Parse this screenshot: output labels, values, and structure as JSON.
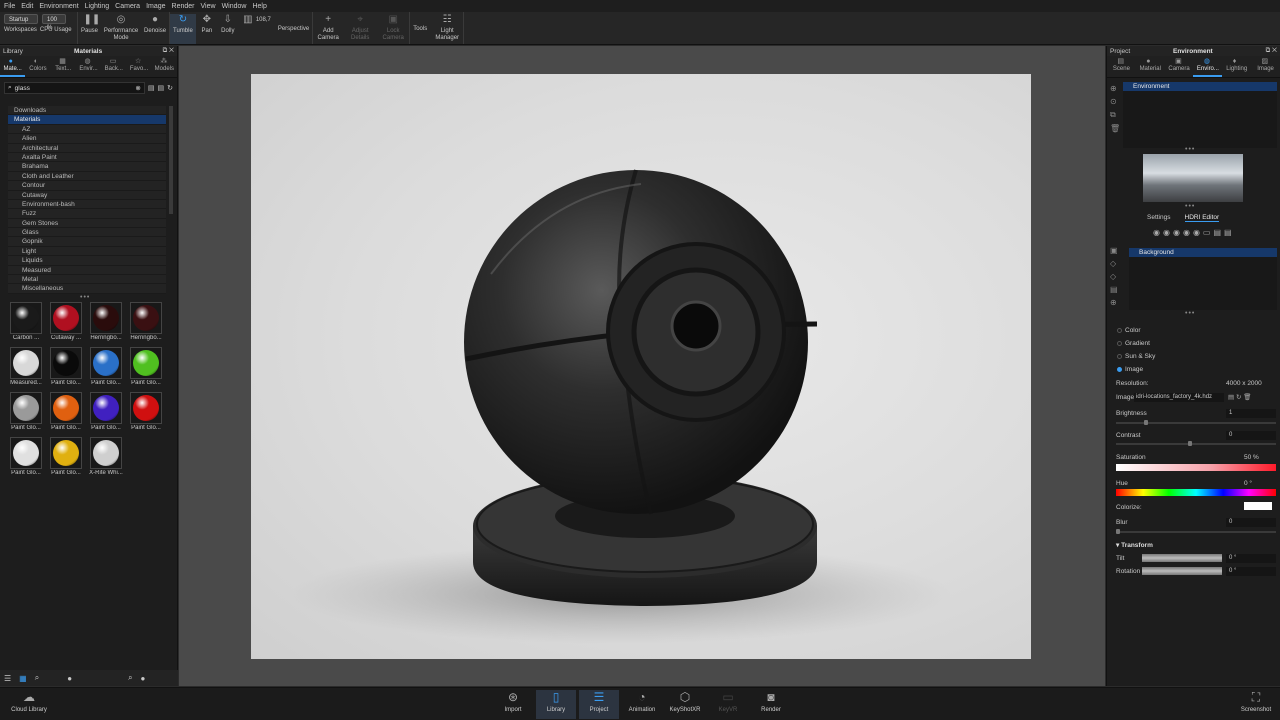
{
  "menu": [
    "File",
    "Edit",
    "Environment",
    "Lighting",
    "Camera",
    "Image",
    "Render",
    "View",
    "Window",
    "Help"
  ],
  "toolbar": {
    "workspace_value": "Startup",
    "cpu_value": "100 %",
    "workspaces_label": "Workspaces",
    "cpu_label": "CPU Usage",
    "pause_label": "Pause",
    "performance_label": "Performance Mode",
    "denoise_label": "Denoise",
    "tumble_label": "Tumble",
    "pan_label": "Pan",
    "dolly_label": "Dolly",
    "fov_value": "108,7",
    "perspective_label": "Perspective",
    "add_camera_label": "Add Camera",
    "adjust_label": "Adjust Details",
    "lock_label": "Lock Camera",
    "tools_label": "Tools",
    "light_manager_label": "Light Manager"
  },
  "library": {
    "title": "Library",
    "header_tab": "Materials",
    "tabs": [
      "Mate...",
      "Colors",
      "Text...",
      "Envir...",
      "Back...",
      "Favo...",
      "Models"
    ],
    "search_value": "glass",
    "tree": [
      {
        "label": "Downloads",
        "level": 0,
        "selected": false
      },
      {
        "label": "Materials",
        "level": 0,
        "selected": true
      },
      {
        "label": "AZ",
        "level": 1
      },
      {
        "label": "Alien",
        "level": 1
      },
      {
        "label": "Architectural",
        "level": 1
      },
      {
        "label": "Axalta Paint",
        "level": 1
      },
      {
        "label": "Brahama",
        "level": 1
      },
      {
        "label": "Cloth and Leather",
        "level": 1
      },
      {
        "label": "Contour",
        "level": 1
      },
      {
        "label": "Cutaway",
        "level": 1
      },
      {
        "label": "Environment-bash",
        "level": 1
      },
      {
        "label": "Fuzz",
        "level": 1
      },
      {
        "label": "Gem Stones",
        "level": 1
      },
      {
        "label": "Glass",
        "level": 1
      },
      {
        "label": "Gopnik",
        "level": 1
      },
      {
        "label": "Light",
        "level": 1
      },
      {
        "label": "Liquids",
        "level": 1
      },
      {
        "label": "Measured",
        "level": 1
      },
      {
        "label": "Metal",
        "level": 1
      },
      {
        "label": "Miscellaneous",
        "level": 1
      }
    ],
    "thumbnails": [
      {
        "label": "Carbon ...",
        "color": "#1a1a1a"
      },
      {
        "label": "Cutaway ...",
        "color": "#b01020"
      },
      {
        "label": "Herringbo...",
        "color": "#2a0c0c"
      },
      {
        "label": "Herringbo...",
        "color": "#3a1012"
      },
      {
        "label": "Measured...",
        "color": "#d8d8d8"
      },
      {
        "label": "Paint Glo...",
        "color": "#0a0a0a"
      },
      {
        "label": "Paint Glo...",
        "color": "#2a70c8"
      },
      {
        "label": "Paint Glo...",
        "color": "#50c020"
      },
      {
        "label": "Paint Glo...",
        "color": "#9a9a9a"
      },
      {
        "label": "Paint Glo...",
        "color": "#e06010"
      },
      {
        "label": "Paint Glo...",
        "color": "#4020c0"
      },
      {
        "label": "Paint Glo...",
        "color": "#d01010"
      },
      {
        "label": "Paint Glo...",
        "color": "#e0e0e0"
      },
      {
        "label": "Paint Glo...",
        "color": "#e0b010"
      },
      {
        "label": "X-Rite Whi...",
        "color": "#cfcfcf"
      }
    ]
  },
  "project": {
    "title": "Project",
    "header_tab": "Environment",
    "tabs": [
      "Scene",
      "Material",
      "Camera",
      "Enviro...",
      "Lighting",
      "Image"
    ],
    "env_item": "Environment",
    "subtabs": [
      "Settings",
      "HDRI Editor"
    ],
    "bg_item": "Background",
    "modes": [
      "Color",
      "Gradient",
      "Sun & Sky",
      "Image"
    ],
    "resolution_label": "Resolution:",
    "resolution_value": "4000 x 2000",
    "image_label": "Image",
    "image_value": "idri-locations_factory_4k.hdz",
    "brightness_label": "Brightness",
    "brightness_value": "1",
    "contrast_label": "Contrast",
    "contrast_value": "0",
    "saturation_label": "Saturation",
    "saturation_value": "50 %",
    "hue_label": "Hue",
    "hue_value": "0 °",
    "colorize_label": "Colorize:",
    "blur_label": "Blur",
    "blur_value": "0",
    "transform_label": "Transform",
    "tilt_label": "Tilt",
    "tilt_value": "0 °",
    "rotation_label": "Rotation",
    "rotation_value": "0 °"
  },
  "bottom": {
    "cloud_label": "Cloud Library",
    "buttons": [
      "Import",
      "Library",
      "Project",
      "Animation",
      "KeyShotXR",
      "KeyVR",
      "Render"
    ],
    "screenshot_label": "Screenshot"
  },
  "colors": {
    "accent": "#3a9cf0",
    "selection": "#16386a"
  }
}
